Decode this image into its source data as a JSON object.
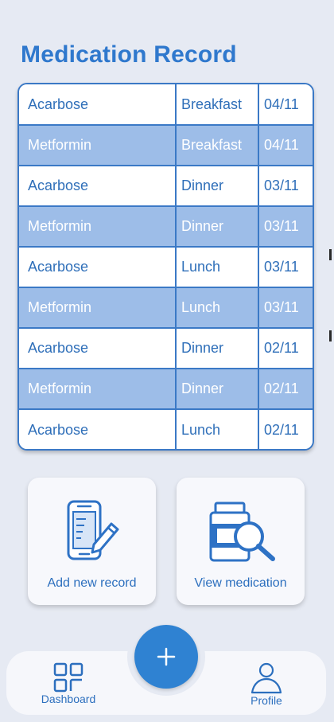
{
  "header": {
    "title": "Medication Record"
  },
  "records": [
    {
      "name": "Acarbose",
      "meal": "Breakfast",
      "date": "04/11",
      "style": "white"
    },
    {
      "name": "Metformin",
      "meal": "Breakfast",
      "date": "04/11",
      "style": "blue"
    },
    {
      "name": "Acarbose",
      "meal": "Dinner",
      "date": "03/11",
      "style": "white"
    },
    {
      "name": "Metformin",
      "meal": "Dinner",
      "date": "03/11",
      "style": "blue"
    },
    {
      "name": "Acarbose",
      "meal": "Lunch",
      "date": "03/11",
      "style": "white"
    },
    {
      "name": "Metformin",
      "meal": "Lunch",
      "date": "03/11",
      "style": "blue"
    },
    {
      "name": "Acarbose",
      "meal": "Dinner",
      "date": "02/11",
      "style": "white"
    },
    {
      "name": "Metformin",
      "meal": "Dinner",
      "date": "02/11",
      "style": "blue"
    },
    {
      "name": "Acarbose",
      "meal": "Lunch",
      "date": "02/11",
      "style": "white"
    }
  ],
  "actions": {
    "add_label": "Add new record",
    "view_label": "View medication"
  },
  "nav": {
    "dashboard_label": "Dashboard",
    "profile_label": "Profile",
    "fab_icon": "plus-icon"
  },
  "colors": {
    "accent": "#2f78cd",
    "row_highlight": "#9dbde8",
    "background": "#e6eaf3"
  }
}
